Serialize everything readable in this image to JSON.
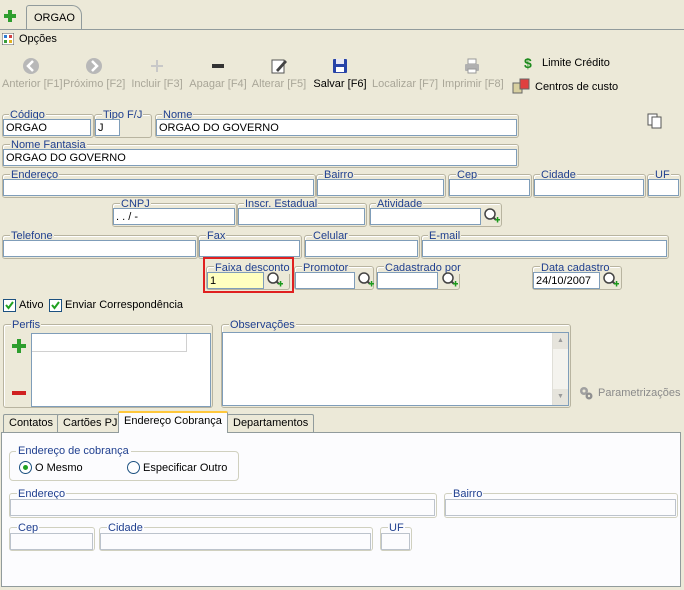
{
  "window_tab": {
    "title": "ORGAO"
  },
  "menu": {
    "options_label": "Opções"
  },
  "toolbar": {
    "anterior": "Anterior [F1]",
    "proximo": "Próximo [F2]",
    "incluir": "Incluir [F3]",
    "apagar": "Apagar [F4]",
    "alterar": "Alterar [F5]",
    "salvar": "Salvar [F6]",
    "localizar": "Localizar [F7]",
    "imprimir": "Imprimir [F8]",
    "limite_credito": "Limite Crédito",
    "centros_custo": "Centros de custo"
  },
  "form": {
    "codigo": {
      "label": "Código",
      "value": "ORGAO"
    },
    "tipo_fj": {
      "label": "Tipo F/J",
      "value": "J"
    },
    "nome": {
      "label": "Nome",
      "value": "ORGAO DO GOVERNO"
    },
    "nome_fantasia": {
      "label": "Nome Fantasia",
      "value": "ORGAO DO GOVERNO"
    },
    "endereco": {
      "label": "Endereço",
      "value": ""
    },
    "bairro": {
      "label": "Bairro",
      "value": ""
    },
    "cep": {
      "label": "Cep",
      "value": ""
    },
    "cidade": {
      "label": "Cidade",
      "value": ""
    },
    "uf": {
      "label": "UF",
      "value": ""
    },
    "cnpj": {
      "label": "CNPJ",
      "value": " .  .  /  -"
    },
    "inscr_estadual": {
      "label": "Inscr. Estadual",
      "value": ""
    },
    "atividade": {
      "label": "Atividade",
      "value": ""
    },
    "telefone": {
      "label": "Telefone",
      "value": ""
    },
    "fax": {
      "label": "Fax",
      "value": ""
    },
    "celular": {
      "label": "Celular",
      "value": ""
    },
    "email": {
      "label": "E-mail",
      "value": ""
    },
    "faixa_desconto": {
      "label": "Faixa desconto",
      "value": "1"
    },
    "promotor": {
      "label": "Promotor",
      "value": ""
    },
    "cadastrado_por": {
      "label": "Cadastrado por",
      "value": ""
    },
    "data_cadastro": {
      "label": "Data cadastro",
      "value": "24/10/2007"
    },
    "ativo": {
      "label": "Ativo",
      "checked": true
    },
    "enviar_correspondencia": {
      "label": "Enviar Correspondência",
      "checked": true
    },
    "perfis": {
      "label": "Perfis"
    },
    "observacoes": {
      "label": "Observações"
    },
    "parametrizacoes": "Parametrizações"
  },
  "tabs": [
    {
      "label": "Contatos"
    },
    {
      "label": "Cartões PJ"
    },
    {
      "label": "Endereço Cobrança"
    },
    {
      "label": "Departamentos"
    }
  ],
  "cobranca": {
    "group_label": "Endereço de cobrança",
    "option_mesmo": "O Mesmo",
    "option_outro": "Especificar Outro",
    "selected": "O Mesmo",
    "endereco_label": "Endereço",
    "bairro_label": "Bairro",
    "cep_label": "Cep",
    "cidade_label": "Cidade",
    "uf_label": "UF"
  },
  "colors": {
    "highlight_border": "#e02020",
    "label_blue": "#1f3f8f",
    "faixa_bg": "#ffffc0"
  }
}
